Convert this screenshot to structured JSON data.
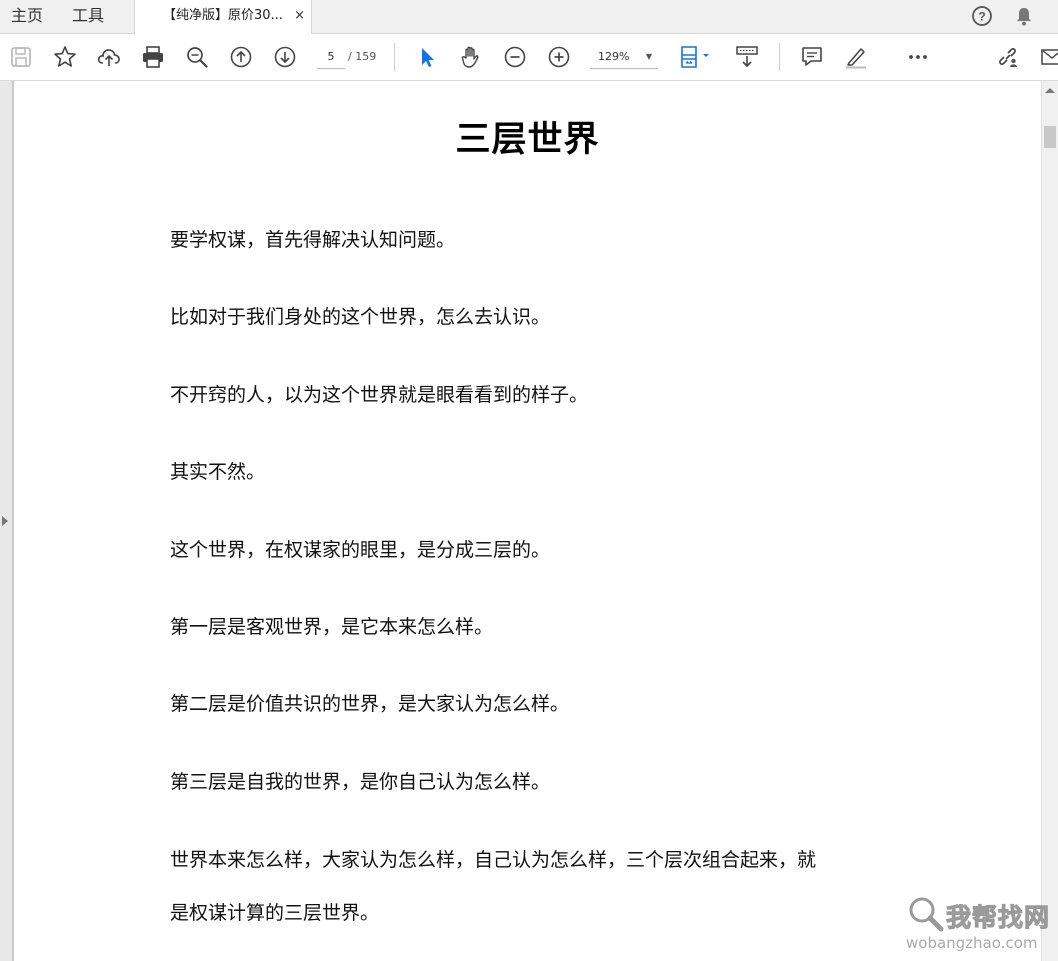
{
  "tabs": {
    "home": "主页",
    "tools": "工具",
    "document_tab": "【纯净版】原价30...",
    "close": "×"
  },
  "toolbar": {
    "page_current": "5",
    "page_total": "/ 159",
    "zoom": "129%",
    "icons": [
      "save-icon",
      "bookmark-star-icon",
      "upload-cloud-icon",
      "print-icon",
      "zoom-search-icon",
      "prev-page-icon",
      "next-page-icon",
      "select-cursor-icon",
      "hand-tool-icon",
      "zoom-out-icon",
      "zoom-in-icon",
      "fit-page-icon",
      "scroll-mode-icon",
      "comment-icon",
      "highlight-pen-icon",
      "more-icon",
      "share-link-icon",
      "email-icon"
    ],
    "accent": "#1473e6"
  },
  "document": {
    "title": "三层世界",
    "paragraphs": [
      "要学权谋，首先得解决认知问题。",
      "比如对于我们身处的这个世界，怎么去认识。",
      "不开窍的人，以为这个世界就是眼看看到的样子。",
      "其实不然。",
      "这个世界，在权谋家的眼里，是分成三层的。",
      "第一层是客观世界，是它本来怎么样。",
      "第二层是价值共识的世界，是大家认为怎么样。",
      "第三层是自我的世界，是你自己认为怎么样。",
      "世界本来怎么样，大家认为怎么样，自己认为怎么样，三个层次组合起来，就",
      "是权谋计算的三层世界。"
    ]
  },
  "watermark": {
    "brand": "我帮找网",
    "url": "wobangzhao.com"
  }
}
